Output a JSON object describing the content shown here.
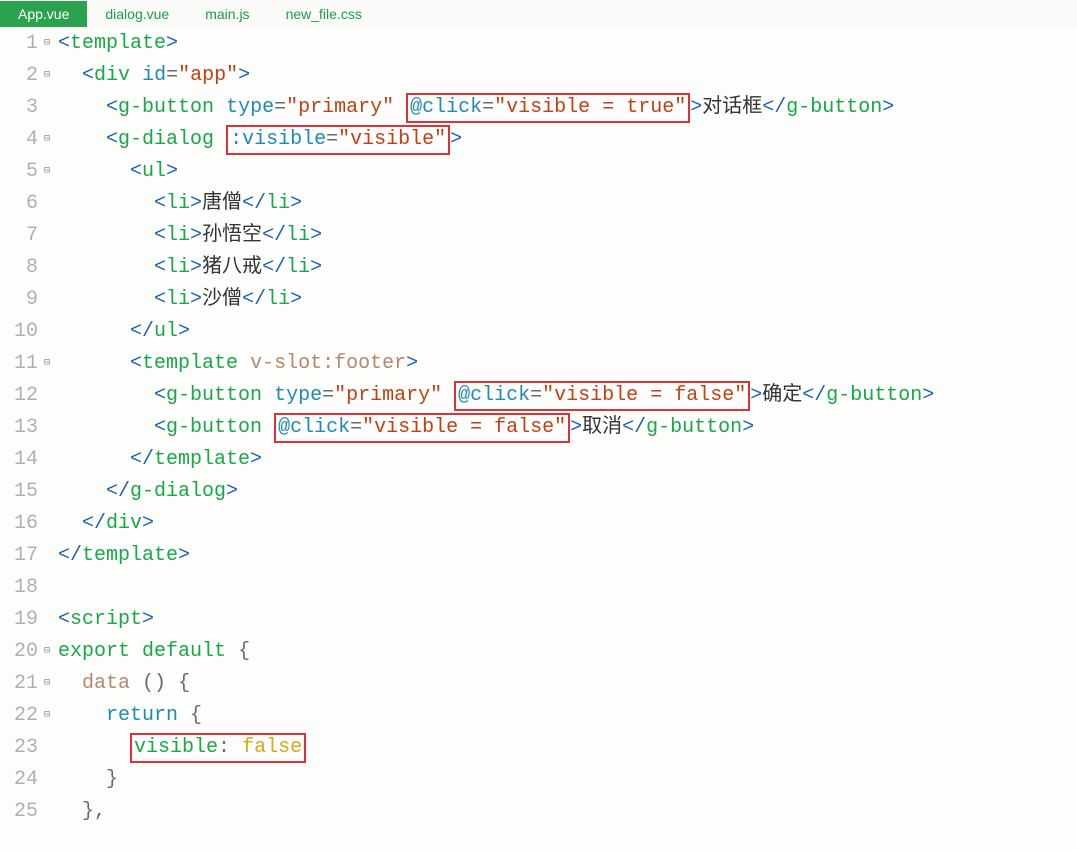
{
  "tabs": [
    {
      "label": "App.vue",
      "active": true
    },
    {
      "label": "dialog.vue",
      "active": false
    },
    {
      "label": "main.js",
      "active": false
    },
    {
      "label": "new_file.css",
      "active": false
    }
  ],
  "lines": {
    "nums": [
      "1",
      "2",
      "3",
      "4",
      "5",
      "6",
      "7",
      "8",
      "9",
      "10",
      "11",
      "12",
      "13",
      "14",
      "15",
      "16",
      "17",
      "18",
      "19",
      "20",
      "21",
      "22",
      "23",
      "24",
      "25"
    ],
    "folds": [
      "⊟",
      "⊟",
      "",
      "⊟",
      "⊟",
      "",
      "",
      "",
      "",
      "",
      "⊟",
      "",
      "",
      "",
      "",
      "",
      "",
      "",
      "",
      "⊟",
      "⊟",
      "⊟",
      "",
      "",
      ""
    ]
  },
  "code": {
    "l1": {
      "tag_open": "<",
      "tagname": "template",
      "tag_close": ">"
    },
    "l2": {
      "indent": "  ",
      "tag_open": "<",
      "tagname": "div",
      "sp": " ",
      "attr": "id",
      "eq": "=",
      "str": "\"app\"",
      "tag_close": ">"
    },
    "l3": {
      "indent": "    ",
      "tag_open": "<",
      "tagname": "g-button",
      "sp": " ",
      "attr1": "type",
      "eq1": "=",
      "str1": "\"primary\"",
      "sp2": " ",
      "box": {
        "attr": "@click",
        "eq": "=",
        "str": "\"visible = true\""
      },
      "tag_close": ">",
      "text": "对话框",
      "close_open": "</",
      "close_name": "g-button",
      "close_close": ">"
    },
    "l4": {
      "indent": "    ",
      "tag_open": "<",
      "tagname": "g-dialog",
      "sp": " ",
      "box": {
        "attr": ":visible",
        "eq": "=",
        "str": "\"visible\""
      },
      "tag_close": ">"
    },
    "l5": {
      "indent": "      ",
      "tag_open": "<",
      "tagname": "ul",
      "tag_close": ">"
    },
    "l6": {
      "indent": "        ",
      "tag_open": "<",
      "tagname": "li",
      "tag_close": ">",
      "text": "唐僧",
      "close_open": "</",
      "close_name": "li",
      "close_close": ">"
    },
    "l7": {
      "indent": "        ",
      "tag_open": "<",
      "tagname": "li",
      "tag_close": ">",
      "text": "孙悟空",
      "close_open": "</",
      "close_name": "li",
      "close_close": ">"
    },
    "l8": {
      "indent": "        ",
      "tag_open": "<",
      "tagname": "li",
      "tag_close": ">",
      "text": "猪八戒",
      "close_open": "</",
      "close_name": "li",
      "close_close": ">"
    },
    "l9": {
      "indent": "        ",
      "tag_open": "<",
      "tagname": "li",
      "tag_close": ">",
      "text": "沙僧",
      "close_open": "</",
      "close_name": "li",
      "close_close": ">"
    },
    "l10": {
      "indent": "      ",
      "close_open": "</",
      "close_name": "ul",
      "close_close": ">"
    },
    "l11": {
      "indent": "      ",
      "tag_open": "<",
      "tagname": "template",
      "sp": " ",
      "attr": "v-slot:footer",
      "tag_close": ">"
    },
    "l12": {
      "indent": "        ",
      "tag_open": "<",
      "tagname": "g-button",
      "sp": " ",
      "attr1": "type",
      "eq1": "=",
      "str1": "\"primary\"",
      "sp2": " ",
      "box": {
        "attr": "@click",
        "eq": "=",
        "str": "\"visible = false\""
      },
      "tag_close": ">",
      "text": "确定",
      "close_open": "</",
      "close_name": "g-button",
      "close_close": ">"
    },
    "l13": {
      "indent": "        ",
      "tag_open": "<",
      "tagname": "g-button",
      "sp": " ",
      "box": {
        "attr": "@click",
        "eq": "=",
        "str": "\"visible = false\""
      },
      "tag_close": ">",
      "text": "取消",
      "close_open": "</",
      "close_name": "g-button",
      "close_close": ">"
    },
    "l14": {
      "indent": "      ",
      "close_open": "</",
      "close_name": "template",
      "close_close": ">"
    },
    "l15": {
      "indent": "    ",
      "close_open": "</",
      "close_name": "g-dialog",
      "close_close": ">"
    },
    "l16": {
      "indent": "  ",
      "close_open": "</",
      "close_name": "div",
      "close_close": ">"
    },
    "l17": {
      "close_open": "</",
      "close_name": "template",
      "close_close": ">"
    },
    "l18": {
      "blank": ""
    },
    "l19": {
      "tag_open": "<",
      "tagname": "script",
      "tag_close": ">"
    },
    "l20": {
      "kw1": "export",
      "sp1": " ",
      "kw2": "default",
      "sp2": " ",
      "brace": "{"
    },
    "l21": {
      "indent": "  ",
      "name": "data",
      "sp": " ",
      "parens": "()",
      "sp2": " ",
      "brace": "{"
    },
    "l22": {
      "indent": "    ",
      "kw": "return",
      "sp": " ",
      "brace": "{"
    },
    "l23": {
      "indent": "      ",
      "box": {
        "prop": "visible",
        "colon": ":",
        "sp": " ",
        "val": "false"
      }
    },
    "l24": {
      "indent": "    ",
      "brace": "}"
    },
    "l25": {
      "indent": "  ",
      "brace": "}",
      "comma": ","
    }
  }
}
